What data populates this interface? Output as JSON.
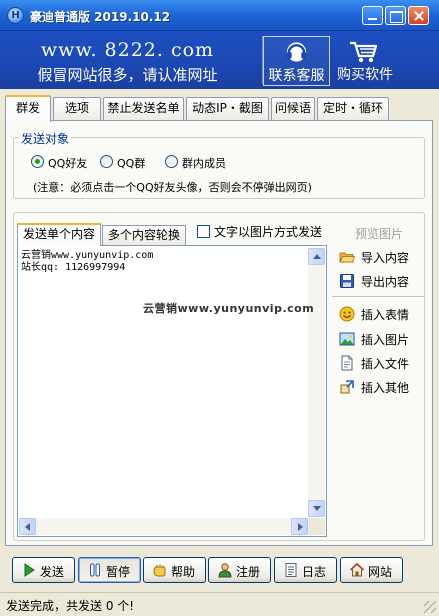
{
  "window": {
    "title": "豪迪普通版 2019.10.12",
    "app_icon_letter": "H",
    "controls": [
      "minimize-icon",
      "maximize-icon",
      "close-icon"
    ]
  },
  "banner": {
    "url": "www. 8222. com",
    "slogan": "假冒网站很多，请认准网址",
    "service_label": "联系客服",
    "service_icon": "headset-icon",
    "buy_label": "购买软件",
    "buy_icon": "cart-icon"
  },
  "tabs": [
    {
      "label": "群发",
      "active": true
    },
    {
      "label": "选项",
      "active": false
    },
    {
      "label": "禁止发送名单",
      "active": false
    },
    {
      "label": "动态IP・截图",
      "active": false
    },
    {
      "label": "问候语",
      "active": false
    },
    {
      "label": "定时・循环",
      "active": false
    }
  ],
  "target": {
    "legend": "发送对象",
    "options": [
      {
        "label": "QQ好友",
        "selected": true
      },
      {
        "label": "QQ群",
        "selected": false
      },
      {
        "label": "群内成员",
        "selected": false
      }
    ],
    "note": "(注意：必须点击一个QQ好友头像，否则会不停弹出网页)"
  },
  "content": {
    "subtabs": [
      {
        "label": "发送单个内容",
        "active": true
      },
      {
        "label": "多个内容轮换",
        "active": false
      }
    ],
    "image_checkbox_label": "文字以图片方式发送",
    "image_checkbox_checked": false,
    "preview_label": "预览图片",
    "editor_text": "云营销www.yunyunvip.com\n站长qq: 1126997994",
    "watermark": "云营销www.yunyunvip.com"
  },
  "side_actions": [
    {
      "label": "导入内容",
      "icon": "folder-open-icon"
    },
    {
      "label": "导出内容",
      "icon": "save-disk-icon"
    },
    {
      "label": "插入表情",
      "icon": "smiley-icon"
    },
    {
      "label": "插入图片",
      "icon": "picture-icon"
    },
    {
      "label": "插入文件",
      "icon": "file-icon"
    },
    {
      "label": "插入其他",
      "icon": "insert-other-icon"
    }
  ],
  "buttons": [
    {
      "label": "发送",
      "icon": "play-icon",
      "pressed": false
    },
    {
      "label": "暂停",
      "icon": "pause-icon",
      "pressed": true
    },
    {
      "label": "帮助",
      "icon": "help-hand-icon",
      "pressed": false
    },
    {
      "label": "注册",
      "icon": "user-icon",
      "pressed": false
    },
    {
      "label": "日志",
      "icon": "log-icon",
      "pressed": false
    },
    {
      "label": "网站",
      "icon": "home-icon",
      "pressed": false
    }
  ],
  "status": {
    "text": "发送完成，共发送 0 个!"
  },
  "colors": {
    "titlebar": "#1f63d6",
    "banner": "#1c47b3",
    "window_bg": "#ece9d8",
    "tab_active_accent": "#f4b43a",
    "group_label": "#003399"
  }
}
